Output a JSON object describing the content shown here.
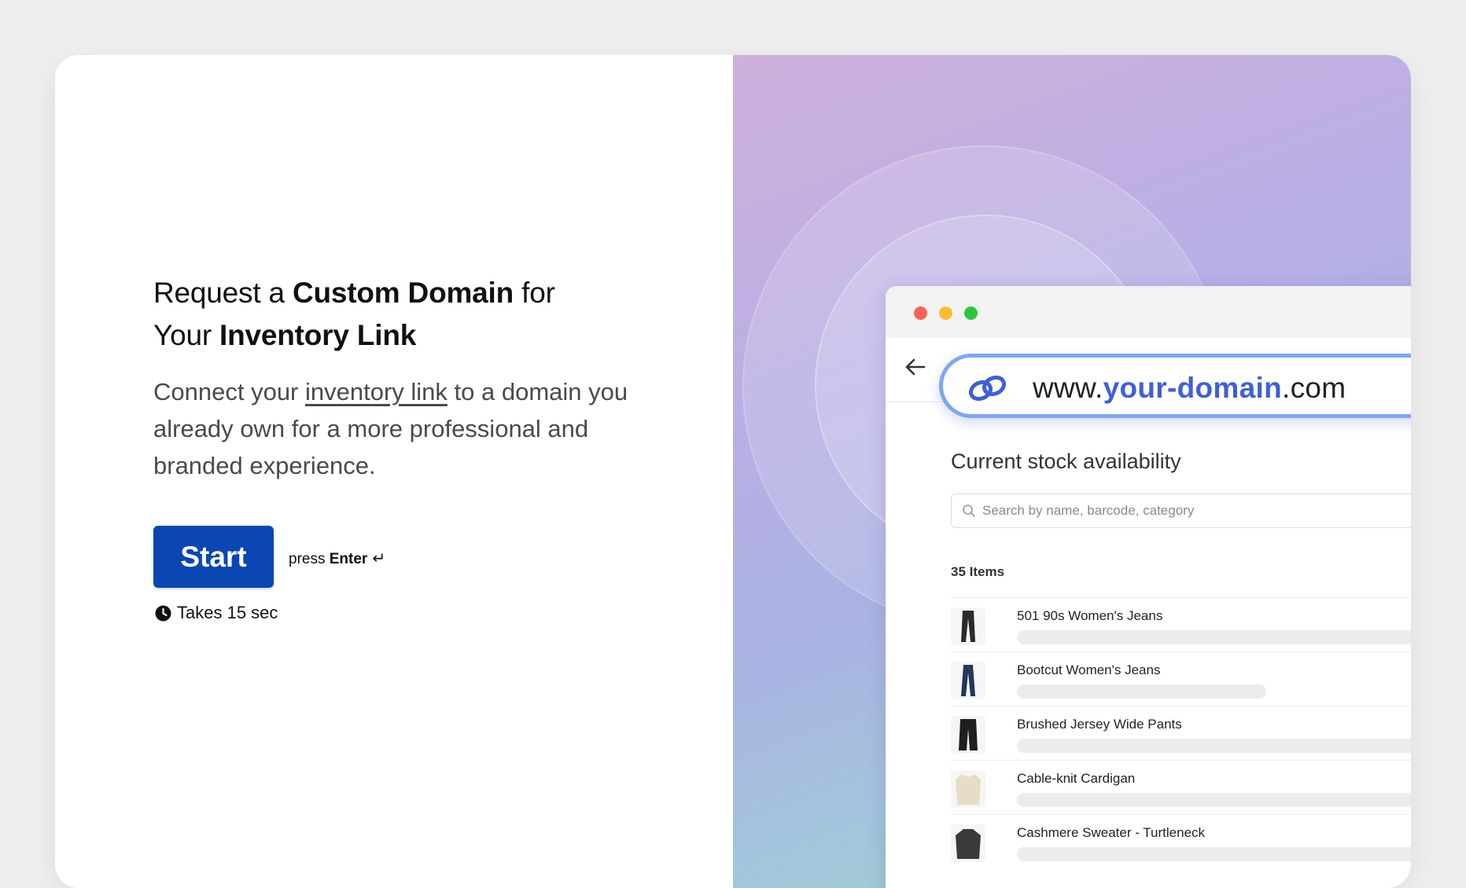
{
  "heading": {
    "part1": "Request a ",
    "bold1": "Custom Domain",
    "part2": " for",
    "part3": "Your ",
    "bold2": "Inventory Link"
  },
  "description": {
    "before_link": "Connect your ",
    "link_text": "inventory link",
    "after_link": " to a domain you already own for a more professional and branded experience."
  },
  "start_button": {
    "label": "Start"
  },
  "press_hint": {
    "prefix": "press ",
    "key": "Enter",
    "icon": "↵"
  },
  "duration": {
    "text": "Takes 15 sec",
    "icon": "clock-icon"
  },
  "browser": {
    "url_prefix": "www.",
    "url_domain": "your-domain",
    "url_suffix": ".com",
    "title": "Current stock availability",
    "search_placeholder": "Search by name, barcode, category",
    "items_count": "35 Items",
    "items": [
      {
        "name": "501 90s Women's Jeans",
        "bar_fraction": 1.0
      },
      {
        "name": "Bootcut Women's Jeans",
        "bar_fraction": 0.57
      },
      {
        "name": "Brushed Jersey Wide Pants",
        "bar_fraction": 1.0
      },
      {
        "name": "Cable-knit Cardigan",
        "bar_fraction": 1.0
      },
      {
        "name": "Cashmere Sweater - Turtleneck",
        "bar_fraction": 1.0
      }
    ]
  },
  "colors": {
    "primary_button": "#0b47b3",
    "url_accent": "#3f5fd8",
    "url_border": "#7ea6f5"
  }
}
